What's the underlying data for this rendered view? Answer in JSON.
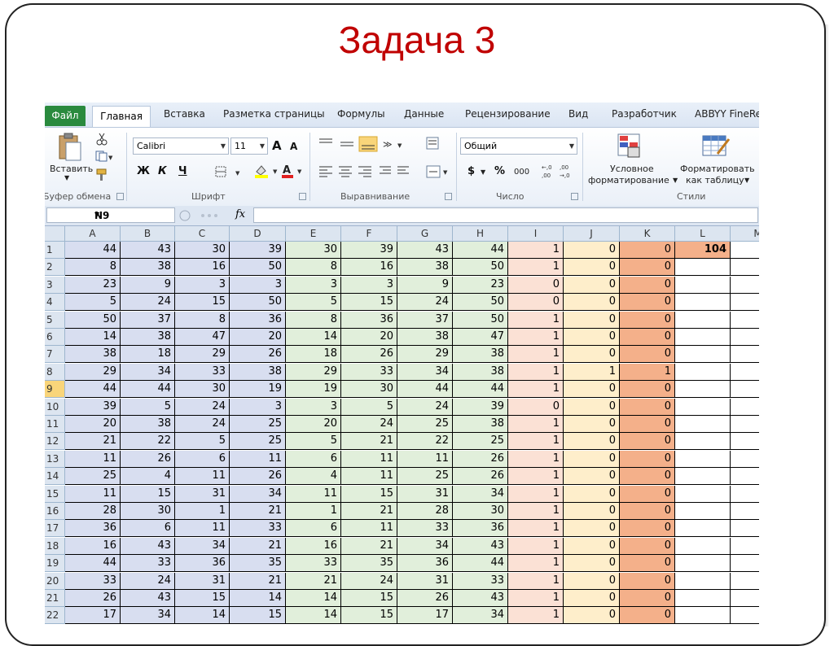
{
  "slide_title": "Задача 3",
  "excel": {
    "tabs": {
      "file": "Файл",
      "home": "Главная",
      "insert": "Вставка",
      "page_layout": "Разметка страницы",
      "formulas": "Формулы",
      "data": "Данные",
      "review": "Рецензирование",
      "view": "Вид",
      "developer": "Разработчик",
      "abbyy": "ABBYY FineRea"
    },
    "ribbon": {
      "paste_label": "Вставить",
      "clipboard_label": "Буфер обмена",
      "font_name": "Calibri",
      "font_size": "11",
      "grow_font": "A",
      "shrink_font": "A",
      "bold": "Ж",
      "italic": "К",
      "underline": "Ч",
      "font_label": "Шрифт",
      "alignment_label": "Выравнивание",
      "number_format": "Общий",
      "currency": "$",
      "percent": "%",
      "thousands": "000",
      "number_label": "Число",
      "conditional_formatting_line1": "Условное",
      "conditional_formatting_line2": "форматирование",
      "format_as_table_line1": "Форматировать",
      "format_as_table_line2": "как таблицу",
      "styles_label": "Стили"
    },
    "name_box": "N9",
    "fx_label": "fx",
    "columns": [
      "A",
      "B",
      "C",
      "D",
      "E",
      "F",
      "G",
      "H",
      "I",
      "J",
      "K",
      "L",
      "M"
    ],
    "selected_row": 9,
    "result_cell_value": "104",
    "rows": [
      {
        "n": "1",
        "v": [
          "44",
          "43",
          "30",
          "39",
          "30",
          "39",
          "43",
          "44",
          "1",
          "0",
          "0"
        ]
      },
      {
        "n": "2",
        "v": [
          "8",
          "38",
          "16",
          "50",
          "8",
          "16",
          "38",
          "50",
          "1",
          "0",
          "0"
        ]
      },
      {
        "n": "3",
        "v": [
          "23",
          "9",
          "3",
          "3",
          "3",
          "3",
          "9",
          "23",
          "0",
          "0",
          "0"
        ]
      },
      {
        "n": "4",
        "v": [
          "5",
          "24",
          "15",
          "50",
          "5",
          "15",
          "24",
          "50",
          "0",
          "0",
          "0"
        ]
      },
      {
        "n": "5",
        "v": [
          "50",
          "37",
          "8",
          "36",
          "8",
          "36",
          "37",
          "50",
          "1",
          "0",
          "0"
        ]
      },
      {
        "n": "6",
        "v": [
          "14",
          "38",
          "47",
          "20",
          "14",
          "20",
          "38",
          "47",
          "1",
          "0",
          "0"
        ]
      },
      {
        "n": "7",
        "v": [
          "38",
          "18",
          "29",
          "26",
          "18",
          "26",
          "29",
          "38",
          "1",
          "0",
          "0"
        ]
      },
      {
        "n": "8",
        "v": [
          "29",
          "34",
          "33",
          "38",
          "29",
          "33",
          "34",
          "38",
          "1",
          "1",
          "1"
        ]
      },
      {
        "n": "9",
        "v": [
          "44",
          "44",
          "30",
          "19",
          "19",
          "30",
          "44",
          "44",
          "1",
          "0",
          "0"
        ]
      },
      {
        "n": "10",
        "v": [
          "39",
          "5",
          "24",
          "3",
          "3",
          "5",
          "24",
          "39",
          "0",
          "0",
          "0"
        ]
      },
      {
        "n": "11",
        "v": [
          "20",
          "38",
          "24",
          "25",
          "20",
          "24",
          "25",
          "38",
          "1",
          "0",
          "0"
        ]
      },
      {
        "n": "12",
        "v": [
          "21",
          "22",
          "5",
          "25",
          "5",
          "21",
          "22",
          "25",
          "1",
          "0",
          "0"
        ]
      },
      {
        "n": "13",
        "v": [
          "11",
          "26",
          "6",
          "11",
          "6",
          "11",
          "11",
          "26",
          "1",
          "0",
          "0"
        ]
      },
      {
        "n": "14",
        "v": [
          "25",
          "4",
          "11",
          "26",
          "4",
          "11",
          "25",
          "26",
          "1",
          "0",
          "0"
        ]
      },
      {
        "n": "15",
        "v": [
          "11",
          "15",
          "31",
          "34",
          "11",
          "15",
          "31",
          "34",
          "1",
          "0",
          "0"
        ]
      },
      {
        "n": "16",
        "v": [
          "28",
          "30",
          "1",
          "21",
          "1",
          "21",
          "28",
          "30",
          "1",
          "0",
          "0"
        ]
      },
      {
        "n": "17",
        "v": [
          "36",
          "6",
          "11",
          "33",
          "6",
          "11",
          "33",
          "36",
          "1",
          "0",
          "0"
        ]
      },
      {
        "n": "18",
        "v": [
          "16",
          "43",
          "34",
          "21",
          "16",
          "21",
          "34",
          "43",
          "1",
          "0",
          "0"
        ]
      },
      {
        "n": "19",
        "v": [
          "44",
          "33",
          "36",
          "35",
          "33",
          "35",
          "36",
          "44",
          "1",
          "0",
          "0"
        ]
      },
      {
        "n": "20",
        "v": [
          "33",
          "24",
          "31",
          "21",
          "21",
          "24",
          "31",
          "33",
          "1",
          "0",
          "0"
        ]
      },
      {
        "n": "21",
        "v": [
          "26",
          "43",
          "15",
          "14",
          "14",
          "15",
          "26",
          "43",
          "1",
          "0",
          "0"
        ]
      },
      {
        "n": "22",
        "v": [
          "17",
          "34",
          "14",
          "15",
          "14",
          "15",
          "17",
          "34",
          "1",
          "0",
          "0"
        ]
      }
    ],
    "colors": {
      "title": "#c00000",
      "cols_a_d": "#d8def0",
      "cols_e_h": "#e1efdb",
      "col_i": "#fbe1d5",
      "col_j": "#feeecb",
      "col_k": "#f4b08a",
      "file_tab": "#2a8a3e"
    }
  }
}
